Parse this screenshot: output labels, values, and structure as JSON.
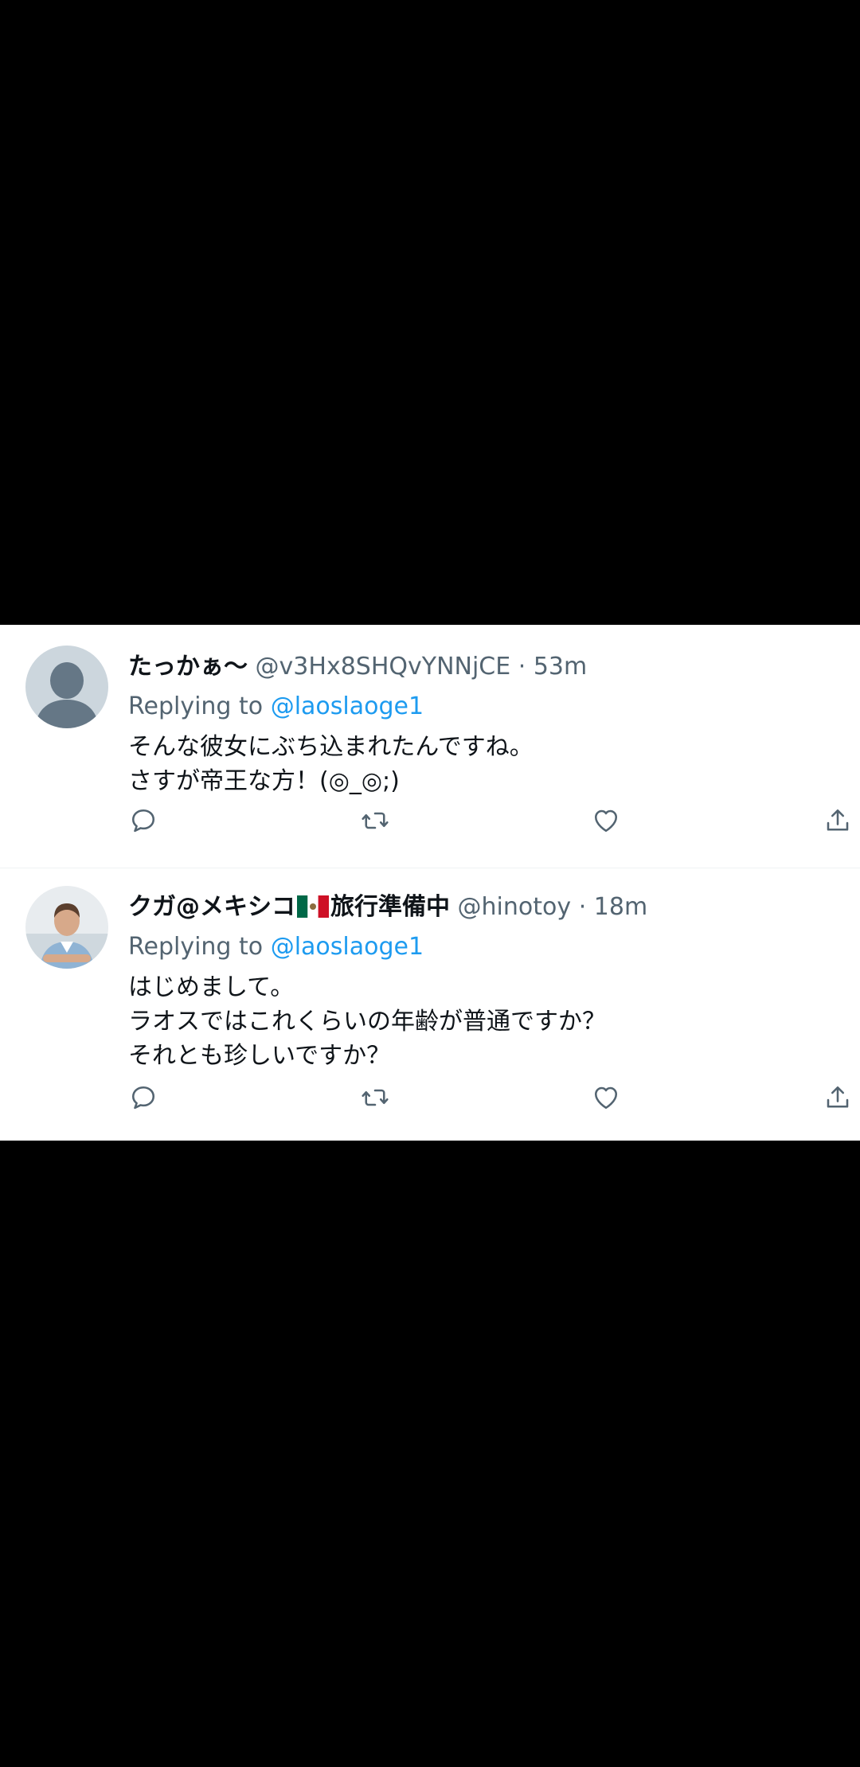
{
  "colors": {
    "text": "#0f1419",
    "secondary": "#536471",
    "link": "#1d9bf0",
    "divider": "#eff3f4"
  },
  "tweets": [
    {
      "display_name": "たっかぁ〜",
      "handle": "@v3Hx8SHQvYNNjCE",
      "time": "53m",
      "replying_label": "Replying to",
      "replying_handle": "@laoslaoge1",
      "lines": [
        "そんな彼女にぶち込まれたんですね。",
        "さすが帝王な方！(◎_◎;)"
      ],
      "avatar": "default-avatar-icon"
    },
    {
      "display_name_pre": "クガ@メキシコ",
      "display_name_post": "旅行準備中",
      "flag": "mexico-flag-icon",
      "handle": "@hinotoy",
      "time": "18m",
      "replying_label": "Replying to",
      "replying_handle": "@laoslaoge1",
      "lines": [
        "はじめまして。",
        "ラオスではこれくらいの年齢が普通ですか？",
        "それとも珍しいですか？"
      ],
      "avatar": "user-photo-avatar"
    }
  ],
  "separator": "·"
}
